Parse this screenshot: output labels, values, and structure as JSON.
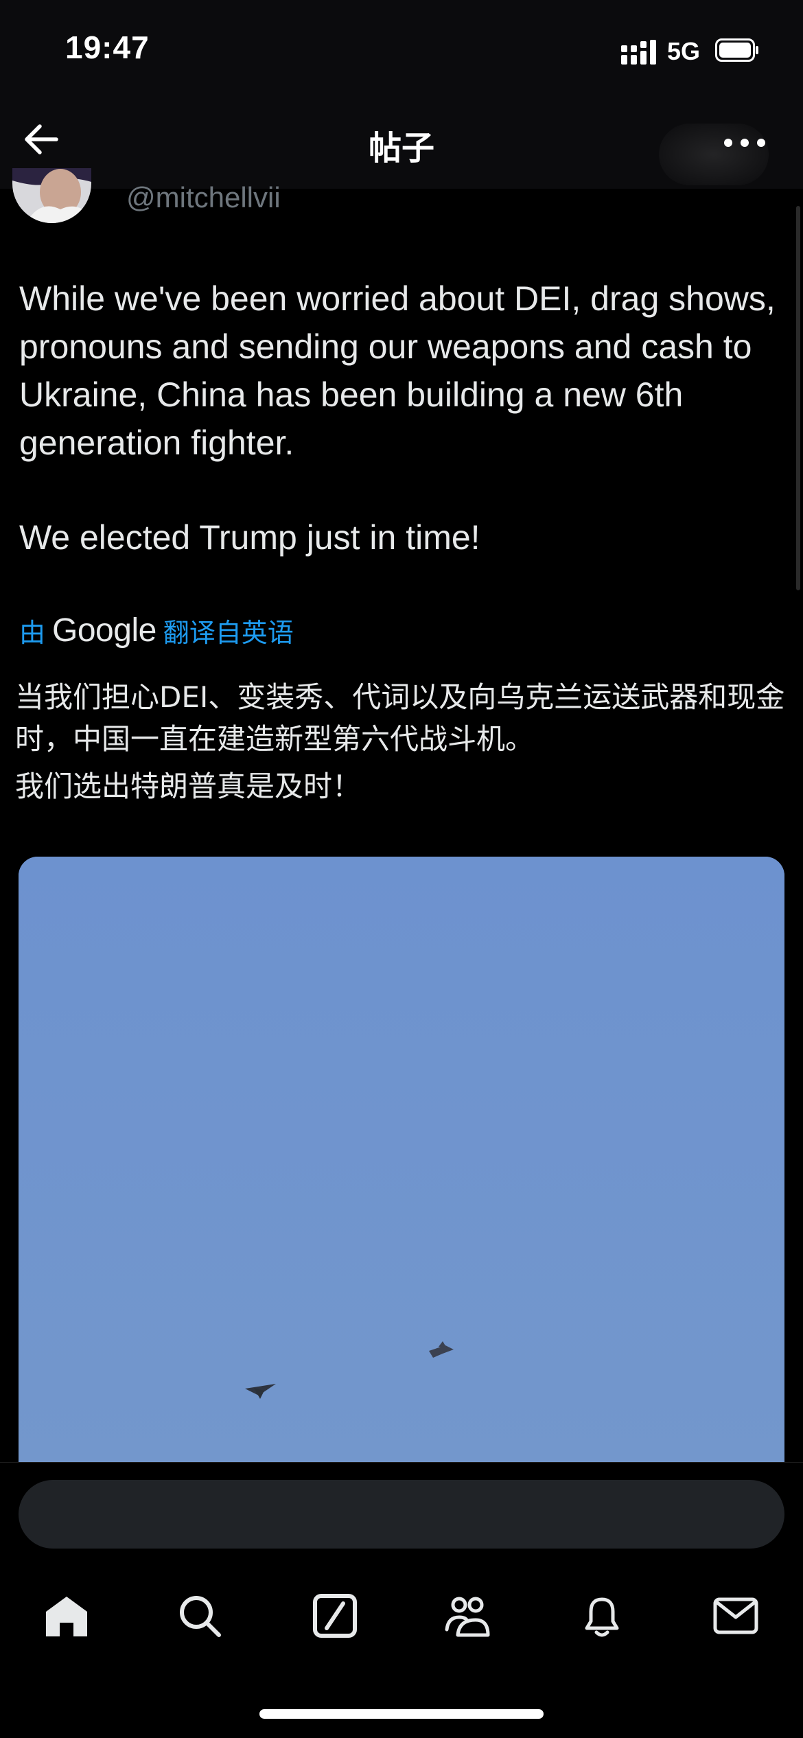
{
  "status_bar": {
    "time": "19:47",
    "network": "5G",
    "icons": [
      "signal-icon",
      "battery-icon"
    ]
  },
  "header": {
    "title": "帖子",
    "back_icon": "arrow-left-icon",
    "more_icon": "more-horizontal-icon"
  },
  "post": {
    "handle": "@mitchellvii",
    "text_paragraphs": [
      "While we've been worried about DEI, drag shows, pronouns and sending our weapons and cash to Ukraine, China has been building a new 6th generation fighter.",
      "We elected Trump just in time!"
    ],
    "translation": {
      "by_label": "由",
      "provider": "Google",
      "link_label": "翻译自英语",
      "paragraphs": [
        "当我们担心DEI、变装秀、代词以及向乌克兰运送武器和现金时，中国一直在建造新型第六代战斗机。",
        "我们选出特朗普真是及时！"
      ]
    },
    "media": {
      "type": "image",
      "icons": [
        "aircraft"
      ]
    }
  },
  "reply": {
    "placeholder": ""
  },
  "bottom_nav": {
    "items": [
      "home-icon",
      "search-icon",
      "grok-icon",
      "communities-icon",
      "notifications-icon",
      "messages-icon"
    ]
  },
  "colors": {
    "background": "#000000",
    "accent": "#1d9bf0",
    "text": "#e7e9ea",
    "secondary_text": "#71767b",
    "sky": "#6f94cf"
  }
}
